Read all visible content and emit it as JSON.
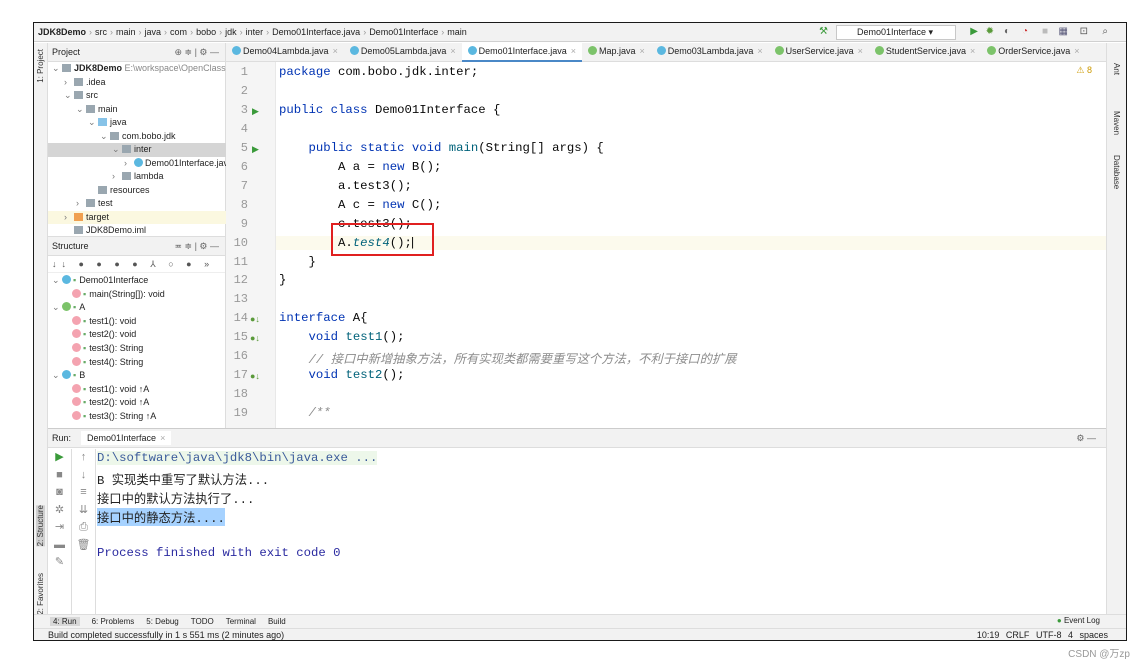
{
  "breadcrumb": [
    "JDK8Demo",
    "src",
    "main",
    "java",
    "com",
    "bobo",
    "jdk",
    "inter",
    "Demo01Interface.java",
    "Demo01Interface",
    "main"
  ],
  "run_config": "Demo01Interface",
  "project": {
    "title": "Project",
    "tree": [
      {
        "label": "JDK8Demo",
        "note": "E:\\workspace\\OpenClass",
        "depth": 0,
        "arrow": "v",
        "icon": "module"
      },
      {
        "label": ".idea",
        "depth": 1,
        "arrow": ">",
        "icon": "folder"
      },
      {
        "label": "src",
        "depth": 1,
        "arrow": "v",
        "icon": "folder"
      },
      {
        "label": "main",
        "depth": 2,
        "arrow": "v",
        "icon": "folder"
      },
      {
        "label": "java",
        "depth": 3,
        "arrow": "v",
        "icon": "blue"
      },
      {
        "label": "com.bobo.jdk",
        "depth": 4,
        "arrow": "v",
        "icon": "folder"
      },
      {
        "label": "inter",
        "depth": 5,
        "arrow": "v",
        "icon": "folder",
        "selected": true
      },
      {
        "label": "Demo01Interface.java",
        "depth": 6,
        "arrow": ">",
        "icon": "class"
      },
      {
        "label": "lambda",
        "depth": 5,
        "arrow": ">",
        "icon": "folder"
      },
      {
        "label": "resources",
        "depth": 3,
        "arrow": "",
        "icon": "folder"
      },
      {
        "label": "test",
        "depth": 2,
        "arrow": ">",
        "icon": "folder"
      },
      {
        "label": "target",
        "depth": 1,
        "arrow": ">",
        "icon": "orange",
        "highlight": true
      },
      {
        "label": "JDK8Demo.iml",
        "depth": 1,
        "arrow": "",
        "icon": "file"
      }
    ]
  },
  "tabs": [
    {
      "label": "Demo04Lambda.java"
    },
    {
      "label": "Demo05Lambda.java"
    },
    {
      "label": "Demo01Interface.java",
      "active": true
    },
    {
      "label": "Map.java"
    },
    {
      "label": "Demo03Lambda.java"
    },
    {
      "label": "UserService.java"
    },
    {
      "label": "StudentService.java"
    },
    {
      "label": "OrderService.java"
    }
  ],
  "editor": {
    "warnings": "8",
    "lines": [
      [
        [
          "kw",
          "package "
        ],
        [
          "",
          "com.bobo.jdk.inter;"
        ]
      ],
      [],
      [
        [
          "kw",
          "public class "
        ],
        [
          "",
          "Demo01Interface {"
        ]
      ],
      [],
      [
        [
          "",
          "    "
        ],
        [
          "kw",
          "public static void "
        ],
        [
          "fn",
          "main"
        ],
        [
          "",
          "(String[] args) {"
        ]
      ],
      [
        [
          "",
          "        A a = "
        ],
        [
          "kw",
          "new "
        ],
        [
          "",
          "B();"
        ]
      ],
      [
        [
          "",
          "        a.test3();"
        ]
      ],
      [
        [
          "",
          "        A c = "
        ],
        [
          "kw",
          "new "
        ],
        [
          "",
          "C();"
        ]
      ],
      [
        [
          "",
          "        c.test3();"
        ]
      ],
      [
        [
          "",
          "        A."
        ],
        [
          "it",
          "test4"
        ],
        [
          "",
          "();"
        ]
      ],
      [
        [
          "",
          "    }"
        ]
      ],
      [
        [
          "",
          "}"
        ]
      ],
      [],
      [
        [
          "kw",
          "interface "
        ],
        [
          "",
          "A{"
        ]
      ],
      [
        [
          "",
          "    "
        ],
        [
          "kw",
          "void "
        ],
        [
          "fn",
          "test1"
        ],
        [
          "",
          "();"
        ]
      ],
      [
        [
          "",
          "    "
        ],
        [
          "cm",
          "// 接口中新增抽象方法，所有实现类都需要重写这个方法，不利于接口的扩展"
        ]
      ],
      [
        [
          "",
          "    "
        ],
        [
          "kw",
          "void "
        ],
        [
          "fn",
          "test2"
        ],
        [
          "",
          "();"
        ]
      ],
      [],
      [
        [
          "",
          "    "
        ],
        [
          "cm",
          "/**"
        ]
      ]
    ]
  },
  "structure": {
    "title": "Structure",
    "items": [
      {
        "label": "Demo01Interface",
        "depth": 0,
        "type": "class"
      },
      {
        "label": "main(String[]): void",
        "depth": 1,
        "type": "m"
      },
      {
        "label": "A",
        "depth": 0,
        "type": "interface"
      },
      {
        "label": "test1(): void",
        "depth": 1,
        "type": "m"
      },
      {
        "label": "test2(): void",
        "depth": 1,
        "type": "m"
      },
      {
        "label": "test3(): String",
        "depth": 1,
        "type": "m"
      },
      {
        "label": "test4(): String",
        "depth": 1,
        "type": "m"
      },
      {
        "label": "B",
        "depth": 0,
        "type": "class"
      },
      {
        "label": "test1(): void ↑A",
        "depth": 1,
        "type": "m"
      },
      {
        "label": "test2(): void ↑A",
        "depth": 1,
        "type": "m"
      },
      {
        "label": "test3(): String ↑A",
        "depth": 1,
        "type": "m"
      }
    ]
  },
  "run": {
    "label": "Run:",
    "tab": "Demo01Interface",
    "output": [
      "D:\\software\\java\\jdk8\\bin\\java.exe ...",
      "B 实现类中重写了默认方法...",
      "接口中的默认方法执行了...",
      "接口中的静态方法....",
      "",
      "Process finished with exit code 0"
    ]
  },
  "left_stripe": [
    "1: Project",
    "2: Structure",
    "2: Favorites"
  ],
  "right_stripe": [
    "Ant",
    "Maven",
    "Database"
  ],
  "bottom_tools": [
    "4: Run",
    "6: Problems",
    "5: Debug",
    "TODO",
    "Terminal",
    "Build"
  ],
  "event_log": "Event Log",
  "status": {
    "message": "Build completed successfully in 1 s 551 ms (2 minutes ago)",
    "position": "10:19",
    "line_sep": "CRLF",
    "encoding": "UTF-8",
    "indent": "4 spaces"
  },
  "watermark": "CSDN @万zp"
}
